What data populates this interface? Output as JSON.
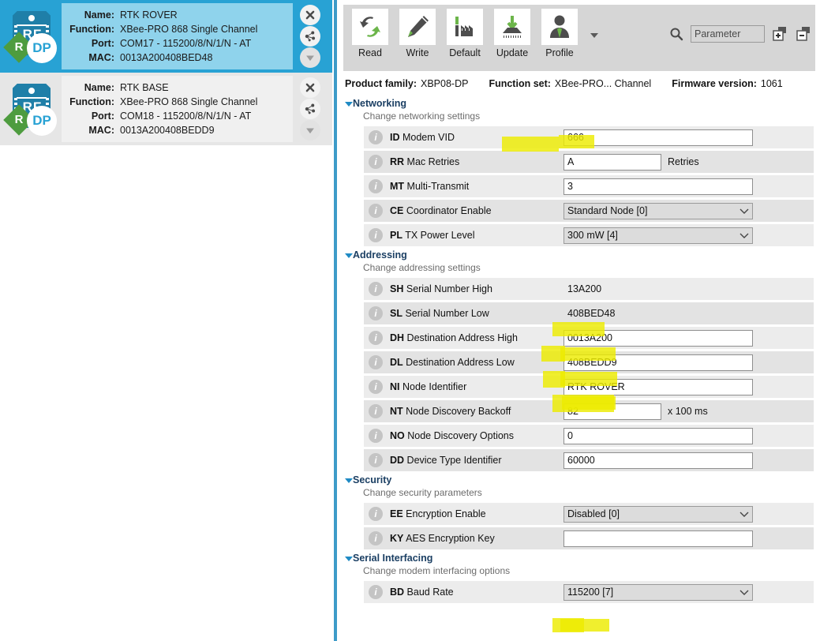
{
  "devices": [
    {
      "selected": true,
      "icon": "xbee-module-icon",
      "fields": [
        {
          "label": "Name:",
          "value": "RTK ROVER"
        },
        {
          "label": "Function:",
          "value": "XBee-PRO 868 Single Channel"
        },
        {
          "label": "Port:",
          "value": "COM17 - 115200/8/N/1/N - AT"
        },
        {
          "label": "MAC:",
          "value": "0013A200408BED48"
        }
      ],
      "actions": [
        "close-icon",
        "network-topology-icon",
        "chevron-down-icon"
      ]
    },
    {
      "selected": false,
      "icon": "xbee-module-icon",
      "fields": [
        {
          "label": "Name:",
          "value": "RTK BASE"
        },
        {
          "label": "Function:",
          "value": "XBee-PRO 868 Single Channel"
        },
        {
          "label": "Port:",
          "value": "COM18 - 115200/8/N/1/N - AT"
        },
        {
          "label": "MAC:",
          "value": "0013A200408BEDD9"
        }
      ],
      "actions": [
        "close-icon",
        "network-topology-icon",
        "chevron-down-icon"
      ]
    }
  ],
  "toolbar": {
    "buttons": [
      {
        "label": "Read",
        "icon": "read-arrows-icon"
      },
      {
        "label": "Write",
        "icon": "write-pencil-icon"
      },
      {
        "label": "Default",
        "icon": "factory-default-icon"
      },
      {
        "label": "Update",
        "icon": "firmware-update-icon"
      },
      {
        "label": "Profile",
        "icon": "profile-person-icon"
      }
    ],
    "more_icon": "chevron-down-icon",
    "search_icon": "search-icon",
    "search_placeholder": "Parameter",
    "search_value": "",
    "expand_all_icon": "expand-all-icon",
    "collapse_all_icon": "collapse-all-icon"
  },
  "meta": [
    {
      "key": "Product family:",
      "value": "XBP08-DP"
    },
    {
      "key": "Function set:",
      "value": "XBee-PRO... Channel"
    },
    {
      "key": "Firmware version:",
      "value": "1061"
    }
  ],
  "sections": [
    {
      "title": "Networking",
      "subtitle": "Change networking settings",
      "rows": [
        {
          "code": "ID",
          "name": "Modem VID",
          "type": "text",
          "value": "666",
          "width": "wide",
          "modified": true,
          "highlight": true,
          "actions": [
            "refresh-icon",
            "write-icon"
          ]
        },
        {
          "code": "RR",
          "name": "Mac Retries",
          "type": "text",
          "value": "A",
          "width": "narrow",
          "unit": "Retries",
          "modified": false,
          "highlight": false,
          "actions": [
            "refresh-icon",
            "write-icon"
          ]
        },
        {
          "code": "MT",
          "name": "Multi-Transmit",
          "type": "text",
          "value": "3",
          "width": "wide",
          "modified": false,
          "highlight": false,
          "actions": [
            "refresh-icon",
            "write-icon"
          ]
        },
        {
          "code": "CE",
          "name": "Coordinator Enable",
          "type": "select",
          "value": "Standard Node [0]",
          "modified": false,
          "highlight": false,
          "actions": [
            "refresh-icon",
            "write-icon"
          ]
        },
        {
          "code": "PL",
          "name": "TX Power Level",
          "type": "select",
          "value": "300 mW [4]",
          "modified": false,
          "highlight": false,
          "actions": [
            "refresh-icon",
            "write-icon"
          ]
        }
      ]
    },
    {
      "title": "Addressing",
      "subtitle": "Change addressing settings",
      "rows": [
        {
          "code": "SH",
          "name": "Serial Number High",
          "type": "readonly",
          "value": "13A200",
          "modified": false,
          "highlight": false,
          "actions": [
            "refresh-icon"
          ]
        },
        {
          "code": "SL",
          "name": "Serial Number Low",
          "type": "readonly",
          "value": "408BED48",
          "modified": false,
          "highlight": true,
          "actions": [
            "refresh-icon"
          ]
        },
        {
          "code": "DH",
          "name": "Destination Address High",
          "type": "text",
          "value": "0013A200",
          "width": "wide",
          "modified": true,
          "highlight": true,
          "actions": [
            "refresh-icon",
            "write-icon"
          ]
        },
        {
          "code": "DL",
          "name": "Destination Address Low",
          "type": "text",
          "value": "408BEDD9",
          "width": "wide",
          "modified": true,
          "highlight": true,
          "actions": [
            "refresh-icon",
            "write-icon"
          ]
        },
        {
          "code": "NI",
          "name": "Node Identifier",
          "type": "text",
          "value": "RTK ROVER",
          "width": "wide",
          "modified": true,
          "highlight": true,
          "actions": [
            "refresh-icon",
            "write-icon"
          ]
        },
        {
          "code": "NT",
          "name": "Node Discovery Backoff",
          "type": "text",
          "value": "82",
          "width": "narrow",
          "unit": "x 100 ms",
          "calc": true,
          "modified": false,
          "highlight": false,
          "actions": [
            "refresh-icon",
            "write-icon"
          ]
        },
        {
          "code": "NO",
          "name": "Node Discovery Options",
          "type": "text",
          "value": "0",
          "width": "wide",
          "modified": false,
          "highlight": false,
          "actions": [
            "refresh-icon",
            "write-icon"
          ]
        },
        {
          "code": "DD",
          "name": "Device Type Identifier",
          "type": "text",
          "value": "60000",
          "width": "wide",
          "modified": true,
          "highlight": false,
          "actions": [
            "refresh-icon",
            "write-icon"
          ]
        }
      ]
    },
    {
      "title": "Security",
      "subtitle": "Change security parameters",
      "rows": [
        {
          "code": "EE",
          "name": "Encryption Enable",
          "type": "select",
          "value": "Disabled [0]",
          "modified": false,
          "highlight": false,
          "actions": [
            "refresh-icon",
            "write-icon"
          ]
        },
        {
          "code": "KY",
          "name": "AES Encryption Key",
          "type": "text",
          "value": "",
          "width": "wide",
          "modified": false,
          "highlight": false,
          "actions": [
            "refresh-icon",
            "write-icon"
          ]
        }
      ]
    },
    {
      "title": "Serial Interfacing",
      "subtitle": "Change modem interfacing options",
      "rows": [
        {
          "code": "BD",
          "name": "Baud Rate",
          "type": "select",
          "value": "115200 [7]",
          "modified": true,
          "highlight": true,
          "actions": [
            "refresh-icon",
            "write-icon"
          ]
        }
      ]
    }
  ],
  "colors": {
    "selected_device": "#28a2d4",
    "accent_blue": "#3d9bc8",
    "section_title": "#1b3f63",
    "highlight_marker": "#edeb00",
    "toolbar_bg": "#d6d6d6",
    "row_bg": "#ececec"
  }
}
